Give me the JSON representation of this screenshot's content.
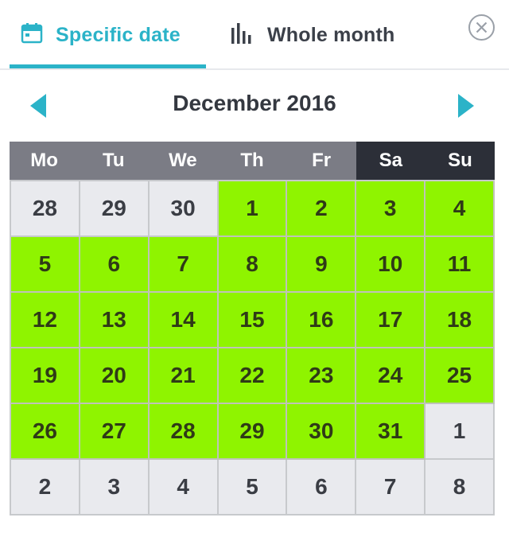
{
  "tabs": {
    "specific_date": "Specific date",
    "whole_month": "Whole month",
    "active": "specific_date"
  },
  "colors": {
    "accent": "#2bb3c8",
    "available": "#8ff400",
    "other_month": "#e9eaee",
    "weekday_header": "#7b7c85",
    "weekend_header": "#2c2f38"
  },
  "icons": {
    "specific_date": "calendar-icon",
    "whole_month": "bar-chart-icon",
    "close": "close-circle-icon",
    "prev": "caret-left-icon",
    "next": "caret-right-icon"
  },
  "calendar": {
    "month_label": "December 2016",
    "weekdays": [
      "Mo",
      "Tu",
      "We",
      "Th",
      "Fr",
      "Sa",
      "Su"
    ],
    "weekend_days": [
      "Sa",
      "Su"
    ],
    "weeks": [
      [
        {
          "day": "28",
          "state": "other"
        },
        {
          "day": "29",
          "state": "other"
        },
        {
          "day": "30",
          "state": "other"
        },
        {
          "day": "1",
          "state": "available"
        },
        {
          "day": "2",
          "state": "available"
        },
        {
          "day": "3",
          "state": "available"
        },
        {
          "day": "4",
          "state": "available"
        }
      ],
      [
        {
          "day": "5",
          "state": "available"
        },
        {
          "day": "6",
          "state": "available"
        },
        {
          "day": "7",
          "state": "available"
        },
        {
          "day": "8",
          "state": "available"
        },
        {
          "day": "9",
          "state": "available"
        },
        {
          "day": "10",
          "state": "available"
        },
        {
          "day": "11",
          "state": "available"
        }
      ],
      [
        {
          "day": "12",
          "state": "available"
        },
        {
          "day": "13",
          "state": "available"
        },
        {
          "day": "14",
          "state": "available"
        },
        {
          "day": "15",
          "state": "available"
        },
        {
          "day": "16",
          "state": "available"
        },
        {
          "day": "17",
          "state": "available"
        },
        {
          "day": "18",
          "state": "available"
        }
      ],
      [
        {
          "day": "19",
          "state": "available"
        },
        {
          "day": "20",
          "state": "available"
        },
        {
          "day": "21",
          "state": "available"
        },
        {
          "day": "22",
          "state": "available"
        },
        {
          "day": "23",
          "state": "available"
        },
        {
          "day": "24",
          "state": "available"
        },
        {
          "day": "25",
          "state": "available"
        }
      ],
      [
        {
          "day": "26",
          "state": "available"
        },
        {
          "day": "27",
          "state": "available"
        },
        {
          "day": "28",
          "state": "available"
        },
        {
          "day": "29",
          "state": "available"
        },
        {
          "day": "30",
          "state": "available"
        },
        {
          "day": "31",
          "state": "available"
        },
        {
          "day": "1",
          "state": "other"
        }
      ],
      [
        {
          "day": "2",
          "state": "other"
        },
        {
          "day": "3",
          "state": "other"
        },
        {
          "day": "4",
          "state": "other"
        },
        {
          "day": "5",
          "state": "other"
        },
        {
          "day": "6",
          "state": "other"
        },
        {
          "day": "7",
          "state": "other"
        },
        {
          "day": "8",
          "state": "other"
        }
      ]
    ]
  }
}
